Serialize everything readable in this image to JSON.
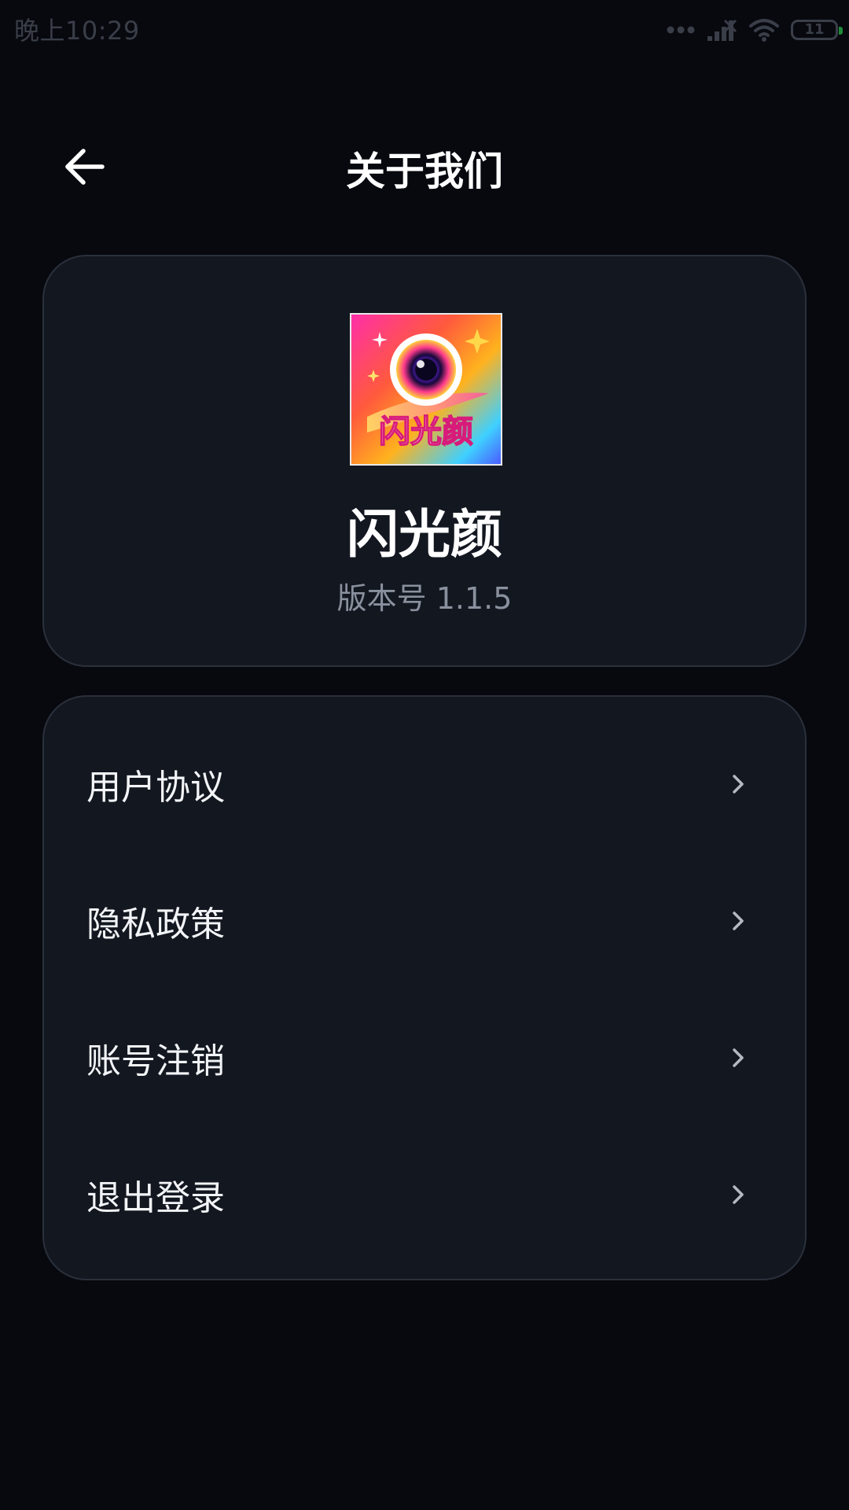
{
  "status_bar": {
    "time": "晚上10:29",
    "battery_level": "11",
    "icons": [
      "more-dots-icon",
      "cellular-signal-icon",
      "wifi-icon",
      "battery-icon"
    ]
  },
  "header": {
    "title": "关于我们",
    "back_icon": "arrow-left-icon"
  },
  "app_info": {
    "logo_text": "闪光颜",
    "name": "闪光颜",
    "version": "版本号 1.1.5"
  },
  "menu": {
    "items": [
      {
        "label": "用户协议",
        "icon": "chevron-right-icon"
      },
      {
        "label": "隐私政策",
        "icon": "chevron-right-icon"
      },
      {
        "label": "账号注销",
        "icon": "chevron-right-icon"
      },
      {
        "label": "退出登录",
        "icon": "chevron-right-icon"
      }
    ]
  },
  "colors": {
    "background": "#07090f",
    "card": "#131720",
    "card_border": "#2a303b",
    "text_primary": "#ffffff",
    "text_secondary": "#8a919e",
    "status_gray": "#3a3e48"
  }
}
